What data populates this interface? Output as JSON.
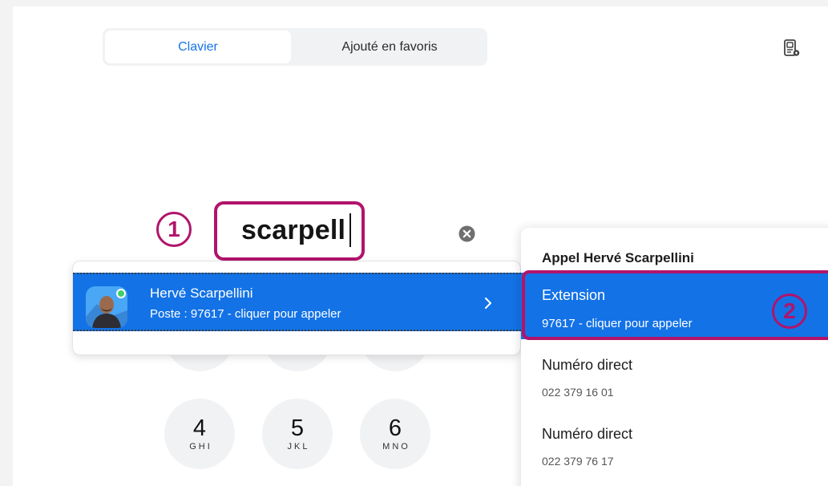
{
  "tabs": {
    "keypad": "Clavier",
    "favorites": "Ajouté en favoris"
  },
  "search": {
    "value": "scarpell"
  },
  "steps": {
    "first": "1",
    "second": "2"
  },
  "result": {
    "name": "Hervé Scarpellini",
    "subtitle": "Poste : 97617  - cliquer pour appeler"
  },
  "dialpad": [
    {
      "digit": "4",
      "letters": "GHI"
    },
    {
      "digit": "5",
      "letters": "JKL"
    },
    {
      "digit": "6",
      "letters": "MNO"
    }
  ],
  "call_options": {
    "title": "Appel Hervé Scarpellini",
    "items": [
      {
        "label": "Extension",
        "value": "97617  - cliquer pour appeler"
      },
      {
        "label": "Numéro direct",
        "value": "022 379 16 01"
      },
      {
        "label": "Numéro direct",
        "value": "022 379 76 17"
      }
    ]
  },
  "colors": {
    "accent": "#1372e6",
    "highlight": "#b1146b"
  },
  "icons": [
    "phonebook-icon",
    "clear-icon",
    "chevron-right-icon",
    "avatar"
  ]
}
